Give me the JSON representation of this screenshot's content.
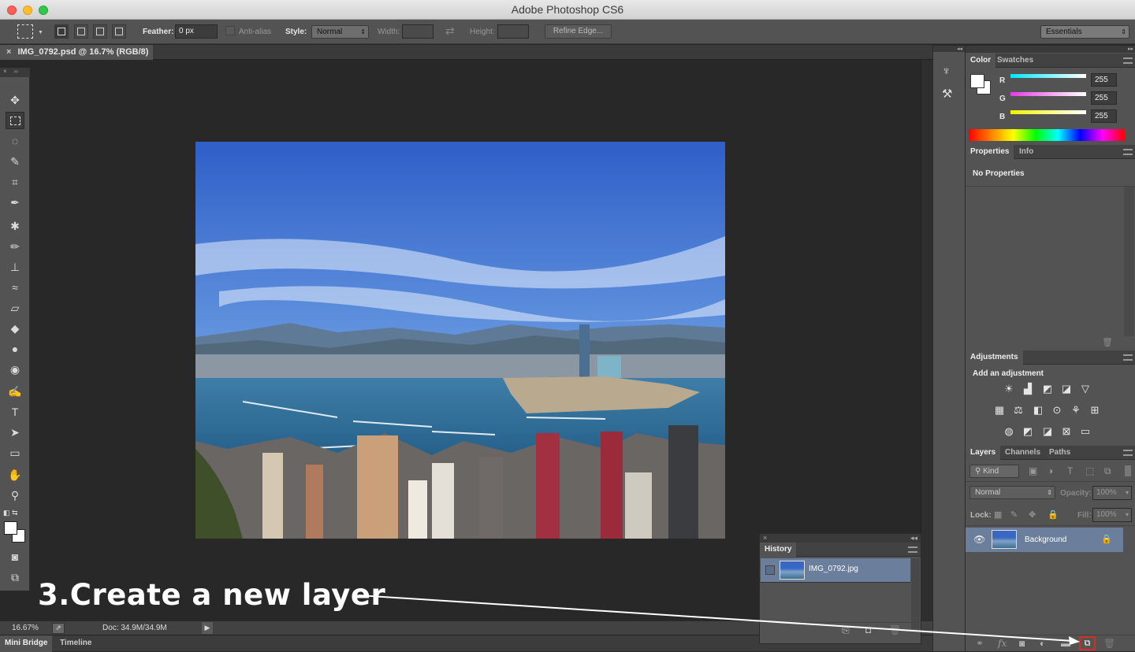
{
  "window": {
    "title": "Adobe Photoshop CS6"
  },
  "options_bar": {
    "feather_label": "Feather:",
    "feather_value": "0 px",
    "antialias_label": "Anti-alias",
    "style_label": "Style:",
    "style_value": "Normal",
    "width_label": "Width:",
    "height_label": "Height:",
    "refine_edge": "Refine Edge...",
    "workspace": "Essentials"
  },
  "document": {
    "tab_title": "IMG_0792.psd @ 16.7% (RGB/8)"
  },
  "status": {
    "zoom": "16.67%",
    "doc_size": "Doc: 34.9M/34.9M"
  },
  "bottom_tabs": [
    "Mini Bridge",
    "Timeline"
  ],
  "color_panel": {
    "tabs": [
      "Color",
      "Swatches"
    ],
    "channels": [
      {
        "label": "R",
        "value": "255",
        "color": "#00e5ff"
      },
      {
        "label": "G",
        "value": "255",
        "color": "#e23ce2"
      },
      {
        "label": "B",
        "value": "255",
        "color": "#f2f200"
      }
    ]
  },
  "properties_panel": {
    "tabs": [
      "Properties",
      "Info"
    ],
    "message": "No Properties"
  },
  "adjustments_panel": {
    "tab": "Adjustments",
    "heading": "Add an adjustment"
  },
  "layers_panel": {
    "tabs": [
      "Layers",
      "Channels",
      "Paths"
    ],
    "filter": "Kind",
    "blend_mode": "Normal",
    "opacity_label": "Opacity:",
    "opacity_value": "100%",
    "lock_label": "Lock:",
    "fill_label": "Fill:",
    "fill_value": "100%",
    "layers": [
      {
        "name": "Background",
        "visible": true,
        "locked": true
      }
    ]
  },
  "history_panel": {
    "tab": "History",
    "items": [
      {
        "name": "IMG_0792.jpg"
      }
    ]
  },
  "annotation": {
    "text": "3.Create a new layer",
    "color": "#ffffff",
    "highlight_color": "#d0321e"
  }
}
